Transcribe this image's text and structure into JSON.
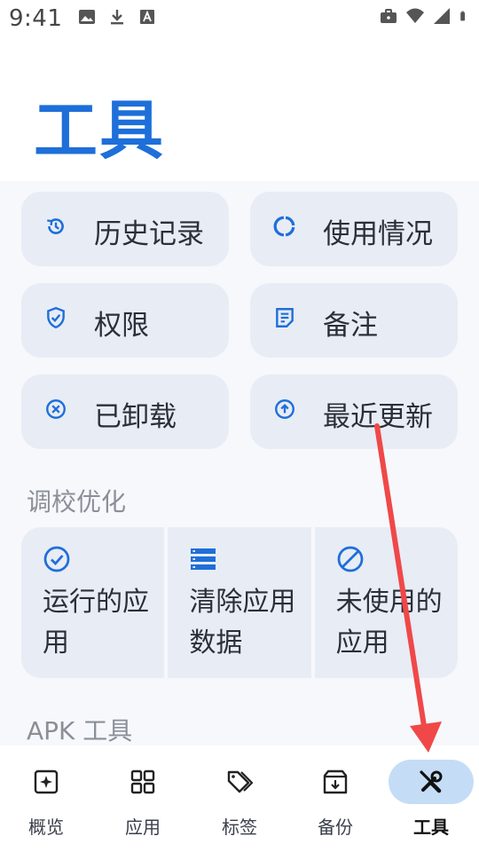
{
  "status_bar": {
    "time": "9:41",
    "left_icons": [
      "image-icon",
      "download-icon",
      "font-icon"
    ],
    "right_icons": [
      "briefcase-icon",
      "wifi-icon",
      "signal-icon",
      "battery-icon"
    ]
  },
  "page": {
    "title": "工具"
  },
  "quick_tools": [
    {
      "label": "历史记录",
      "icon": "history-icon"
    },
    {
      "label": "使用情况",
      "icon": "usage-icon"
    },
    {
      "label": "权限",
      "icon": "shield-icon"
    },
    {
      "label": "备注",
      "icon": "note-icon"
    },
    {
      "label": "已卸载",
      "icon": "cancel-circle-icon"
    },
    {
      "label": "最近更新",
      "icon": "upload-circle-icon"
    }
  ],
  "optimization": {
    "header": "调校优化",
    "items": [
      {
        "label": "运行的应用",
        "icon": "check-circle-icon"
      },
      {
        "label": "清除应用数据",
        "icon": "storage-icon"
      },
      {
        "label": "未使用的应用",
        "icon": "block-icon"
      }
    ]
  },
  "apk_tools": {
    "header": "APK 工具"
  },
  "bottom_nav": {
    "active": "tools",
    "items": [
      {
        "label": "概览",
        "icon": "overview-icon"
      },
      {
        "label": "应用",
        "icon": "apps-grid-icon"
      },
      {
        "label": "标签",
        "icon": "tags-icon"
      },
      {
        "label": "备份",
        "icon": "archive-icon"
      },
      {
        "label": "工具",
        "icon": "tools-icon"
      }
    ]
  },
  "colors": {
    "accent": "#1e6fd9",
    "tile_bg": "#e8ecf5",
    "active_pill": "#c5dcf7",
    "annotation_arrow": "#f04848"
  }
}
